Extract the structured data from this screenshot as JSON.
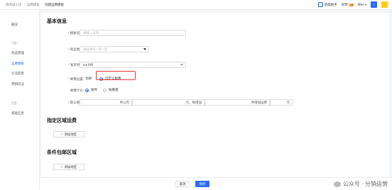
{
  "breadcrumbs": [
    "微商城小店",
    "运费模板",
    "创建运费模板"
  ],
  "header": {
    "assistant_label": "智能助手",
    "notice_label": "有赞",
    "notice_count": "3",
    "user_name": "孙M",
    "help_label": "?"
  },
  "sidebar": {
    "overview": "概况",
    "group_function": "功能",
    "item_goods": "商品管理",
    "item_freight": "运费模板",
    "item_reviews": "引流获客",
    "item_marketing": "营销玩法",
    "group_settings": "设置",
    "item_basic": "基础信息"
  },
  "form": {
    "section_basic": "基本信息",
    "name_label": "模板名称:",
    "name_placeholder": "请输入名称",
    "region_label": "商品地址:",
    "region_placeholder": "请选择省 / 市 / 区",
    "ship_time_label": "发货时间:",
    "ship_time_value": "24小时",
    "free_label": "邮费设置:",
    "free_opt_1": "包邮",
    "free_opt_2": "自定义邮费",
    "calc_label": "邮费计价:",
    "calc_opt_1": "按件",
    "calc_opt_2": "按重量",
    "default_label": "默认邮费:",
    "fee_cell_1": "件以内",
    "fee_cell_2": "元，每增加",
    "fee_cell_3": "件增加运费",
    "fee_cell_4": "元",
    "section_region": "指定区域运费",
    "add_region_1": "添加地区",
    "section_free_cond": "条件包邮区域",
    "add_region_2": "添加地区"
  },
  "footer": {
    "cancel_label": "取消",
    "save_label": "保存",
    "watermark_text": "公众号 · 分销运营"
  }
}
